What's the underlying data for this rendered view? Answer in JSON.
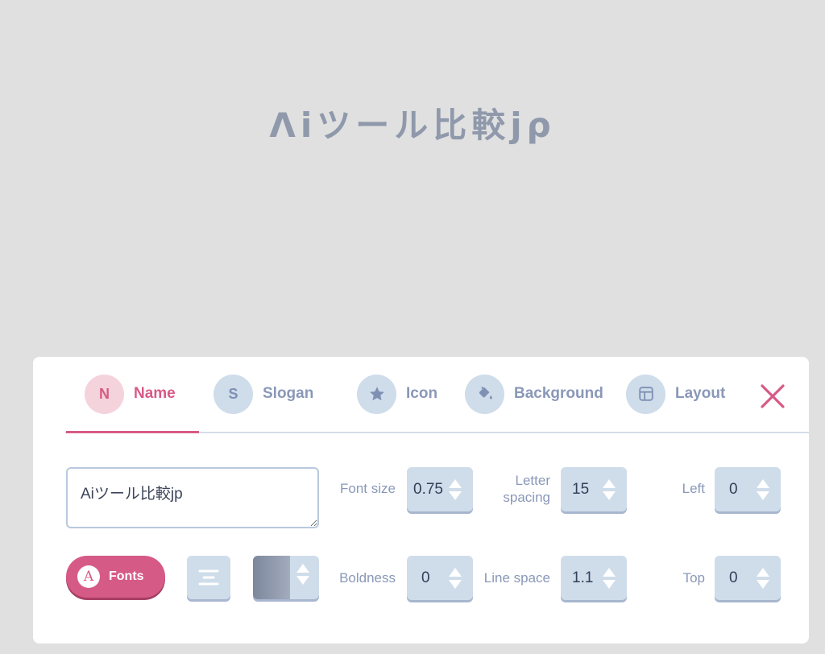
{
  "preview": {
    "logo_text": "Λiツール比較jρ"
  },
  "tabs": [
    {
      "letter": "N",
      "label": "Name",
      "icon": "letter-n",
      "active": true
    },
    {
      "letter": "S",
      "label": "Slogan",
      "icon": "letter-s",
      "active": false
    },
    {
      "letter": "",
      "label": "Icon",
      "icon": "star-icon",
      "active": false
    },
    {
      "letter": "",
      "label": "Background",
      "icon": "paint-bucket-icon",
      "active": false
    },
    {
      "letter": "",
      "label": "Layout",
      "icon": "layout-icon",
      "active": false
    }
  ],
  "close_icon": "close-icon",
  "name_field": {
    "value": "Aiツール比較jp"
  },
  "controls": {
    "font_size": {
      "label": "Font size",
      "value": "0.75"
    },
    "letter_spacing": {
      "label_line1": "Letter",
      "label_line2": "spacing",
      "value": "15"
    },
    "left": {
      "label": "Left",
      "value": "0"
    },
    "boldness": {
      "label": "Boldness",
      "value": "0"
    },
    "line_space": {
      "label": "Line space",
      "value": "1.1"
    },
    "top": {
      "label": "Top",
      "value": "0"
    }
  },
  "fonts_button": {
    "icon_letter": "A",
    "label": "Fonts"
  },
  "align_button": {
    "icon": "align-center-icon"
  },
  "color": {
    "swatch_start": "#7d879c",
    "swatch_end": "#a3acbd"
  },
  "colors": {
    "accent": "#d65a86",
    "tab_circle": "#cfdcea",
    "text_muted": "#8a98b8",
    "background": "#e0e0e0"
  }
}
